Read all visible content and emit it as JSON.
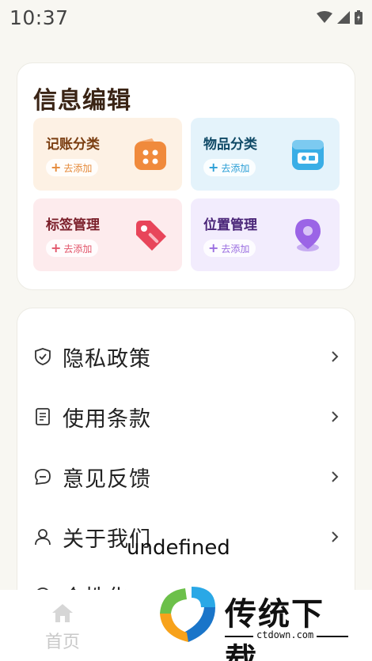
{
  "status": {
    "time": "10:37"
  },
  "info_card": {
    "title": "信息编辑",
    "tiles": [
      {
        "label": "记账分类",
        "add_label": "去添加",
        "icon": "wallet-grid-icon",
        "accent": "#e58a3a"
      },
      {
        "label": "物品分类",
        "add_label": "去添加",
        "icon": "item-box-icon",
        "accent": "#2c9fd6"
      },
      {
        "label": "标签管理",
        "add_label": "去添加",
        "icon": "tag-icon",
        "accent": "#e2556a"
      },
      {
        "label": "位置管理",
        "add_label": "去添加",
        "icon": "location-pin-icon",
        "accent": "#9a6ee0"
      }
    ]
  },
  "menu": {
    "items": [
      {
        "label": "隐私政策",
        "icon": "shield-check-icon"
      },
      {
        "label": "使用条款",
        "icon": "document-icon"
      },
      {
        "label": "意见反馈",
        "icon": "chat-bubble-icon"
      },
      {
        "label": "关于我们",
        "icon": "user-icon"
      },
      {
        "label": "个性化",
        "icon": "circle-icon"
      }
    ]
  },
  "overlay_text": "undefined",
  "tab_bar": {
    "home_label": "首页"
  },
  "watermark": {
    "title": "传统下载",
    "url": "ctdown.com"
  }
}
